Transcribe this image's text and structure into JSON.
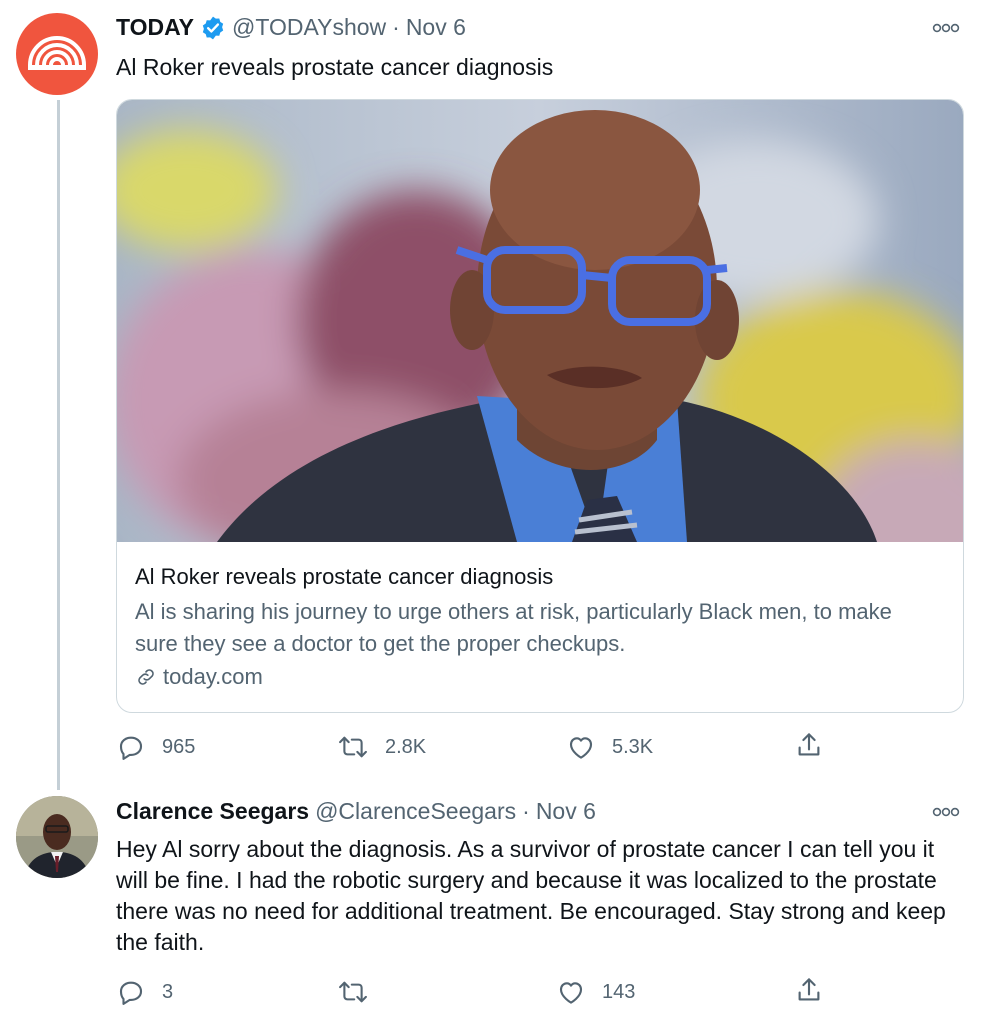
{
  "tweet1": {
    "name": "TODAY",
    "handle": "@TODAYshow",
    "separator": "·",
    "date": "Nov 6",
    "text": "Al Roker reveals prostate cancer diagnosis",
    "card": {
      "title": "Al Roker reveals prostate cancer diagnosis",
      "description": "Al is sharing his journey to urge others at risk, particularly Black men, to make sure they see a doctor to get the proper checkups.",
      "domain": "today.com"
    },
    "actions": {
      "replies": "965",
      "retweets": "2.8K",
      "likes": "5.3K"
    }
  },
  "tweet2": {
    "name": "Clarence Seegars",
    "handle": "@ClarenceSeegars",
    "separator": "·",
    "date": "Nov 6",
    "text": "Hey Al sorry about the diagnosis. As a survivor of prostate cancer I can tell you it will be fine. I had the robotic surgery and because it was localized to the prostate there was no need for additional treatment. Be encouraged. Stay strong and keep the faith.",
    "actions": {
      "replies": "3",
      "retweets": "",
      "likes": "143"
    }
  },
  "colors": {
    "brand_today": "#f0553e",
    "verified": "#1d9bf0",
    "muted": "#536471",
    "thread_line": "#c4cfd6"
  },
  "icons": [
    "verified-badge-icon",
    "more-icon",
    "reply-icon",
    "retweet-icon",
    "like-icon",
    "share-icon",
    "link-icon"
  ]
}
